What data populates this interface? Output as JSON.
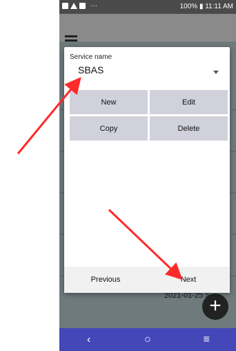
{
  "status": {
    "dots": "···",
    "right_text": "100% ▮ 11:11 AM"
  },
  "app": {
    "bg_date": "2021-01-25 S"
  },
  "dialog": {
    "service_label": "Service name",
    "service_value": "SBAS",
    "buttons": {
      "new": "New",
      "edit": "Edit",
      "copy": "Copy",
      "delete": "Delete"
    },
    "footer": {
      "previous": "Previous",
      "next": "Next"
    }
  },
  "nav": {
    "back": "‹",
    "home": "○",
    "recent": "≡"
  },
  "annotations": {
    "arrow_color": "#ff2a2a"
  }
}
